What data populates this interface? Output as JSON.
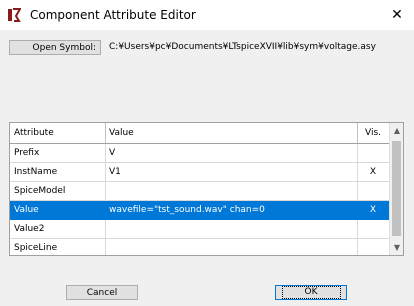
{
  "window": {
    "title": "Component Attribute Editor",
    "close_glyph": "✕",
    "app_icon": "ltspice-icon"
  },
  "symbol": {
    "open_label": "Open Symbol:",
    "path": "C:¥Users¥pc¥Documents¥LTspiceXVII¥lib¥sym¥voltage.asy"
  },
  "table": {
    "headers": {
      "attribute": "Attribute",
      "value": "Value",
      "vis": "Vis."
    },
    "rows": [
      {
        "attribute": "Prefix",
        "value": "V",
        "vis": ""
      },
      {
        "attribute": "InstName",
        "value": "V1",
        "vis": "X"
      },
      {
        "attribute": "SpiceModel",
        "value": "",
        "vis": ""
      },
      {
        "attribute": "Value",
        "value": "wavefile=\"tst_sound.wav\" chan=0",
        "vis": "X",
        "selected": true
      },
      {
        "attribute": "Value2",
        "value": "",
        "vis": ""
      },
      {
        "attribute": "SpiceLine",
        "value": "",
        "vis": ""
      }
    ],
    "selection_color": "#0078d7"
  },
  "buttons": {
    "cancel": "Cancel",
    "ok": "OK"
  }
}
